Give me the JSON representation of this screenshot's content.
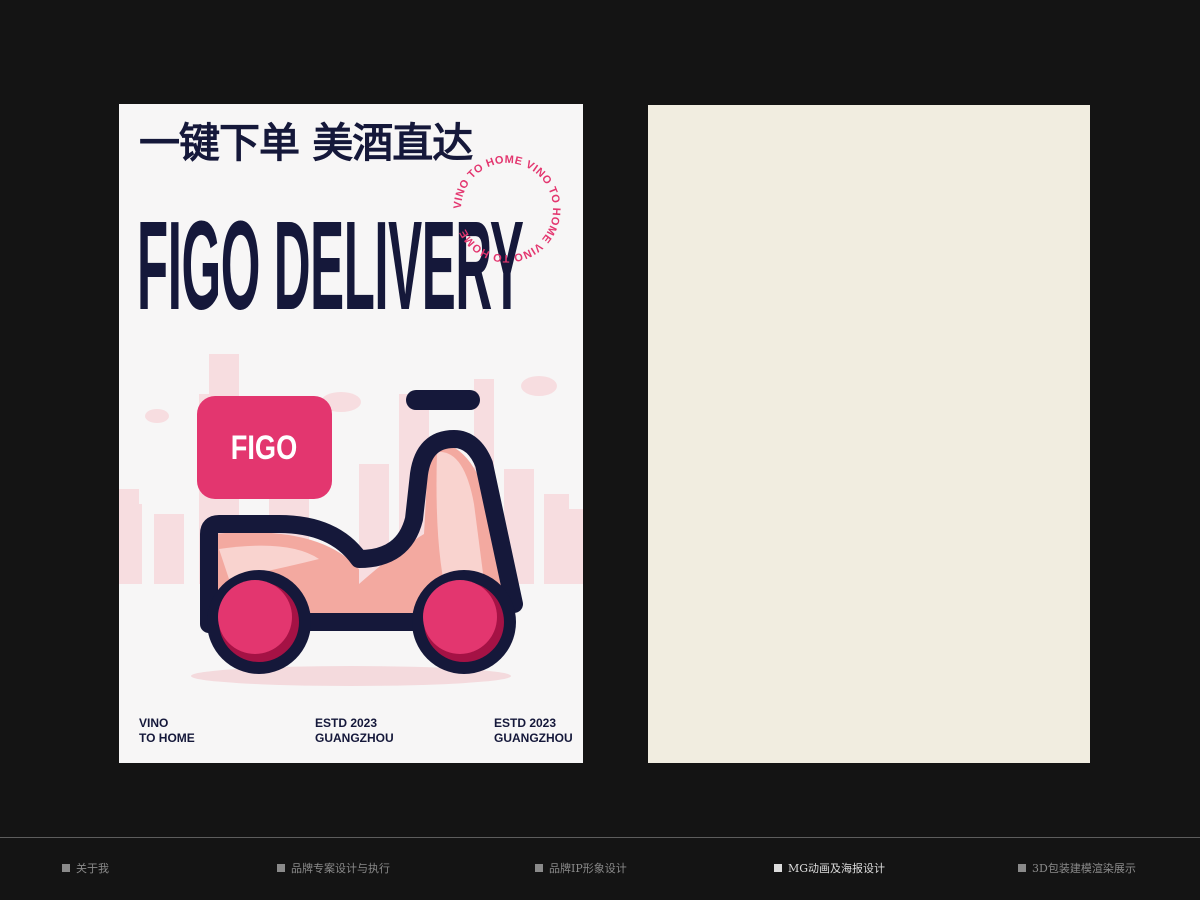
{
  "poster": {
    "headline_cn": "一键下单 美酒直达",
    "headline_en": "FIGO DELIVERY",
    "stamp_text": "VINO TO HOME VINO TO HOME VINO TO HOME ",
    "box_label": "FIGO",
    "footer": [
      {
        "line1": "VINO",
        "line2": "TO HOME"
      },
      {
        "line1": "ESTD 2023",
        "line2": "GUANGZHOU"
      },
      {
        "line1": "ESTD 2023",
        "line2": "GUANGZHOU"
      }
    ],
    "colors": {
      "navy": "#15183a",
      "pink": "#e3366f",
      "salmon": "#f3a9a0",
      "light_pink": "#f9d3cf",
      "city": "#f7dde0"
    }
  },
  "nav": {
    "items": [
      {
        "label": "关于我",
        "active": false
      },
      {
        "label": "品牌专案设计与执行",
        "active": false
      },
      {
        "label": "品牌IP形象设计",
        "active": false
      },
      {
        "label": "MG动画及海报设计",
        "active": true
      },
      {
        "label": "3D包装建模渲染展示",
        "active": false
      }
    ]
  }
}
